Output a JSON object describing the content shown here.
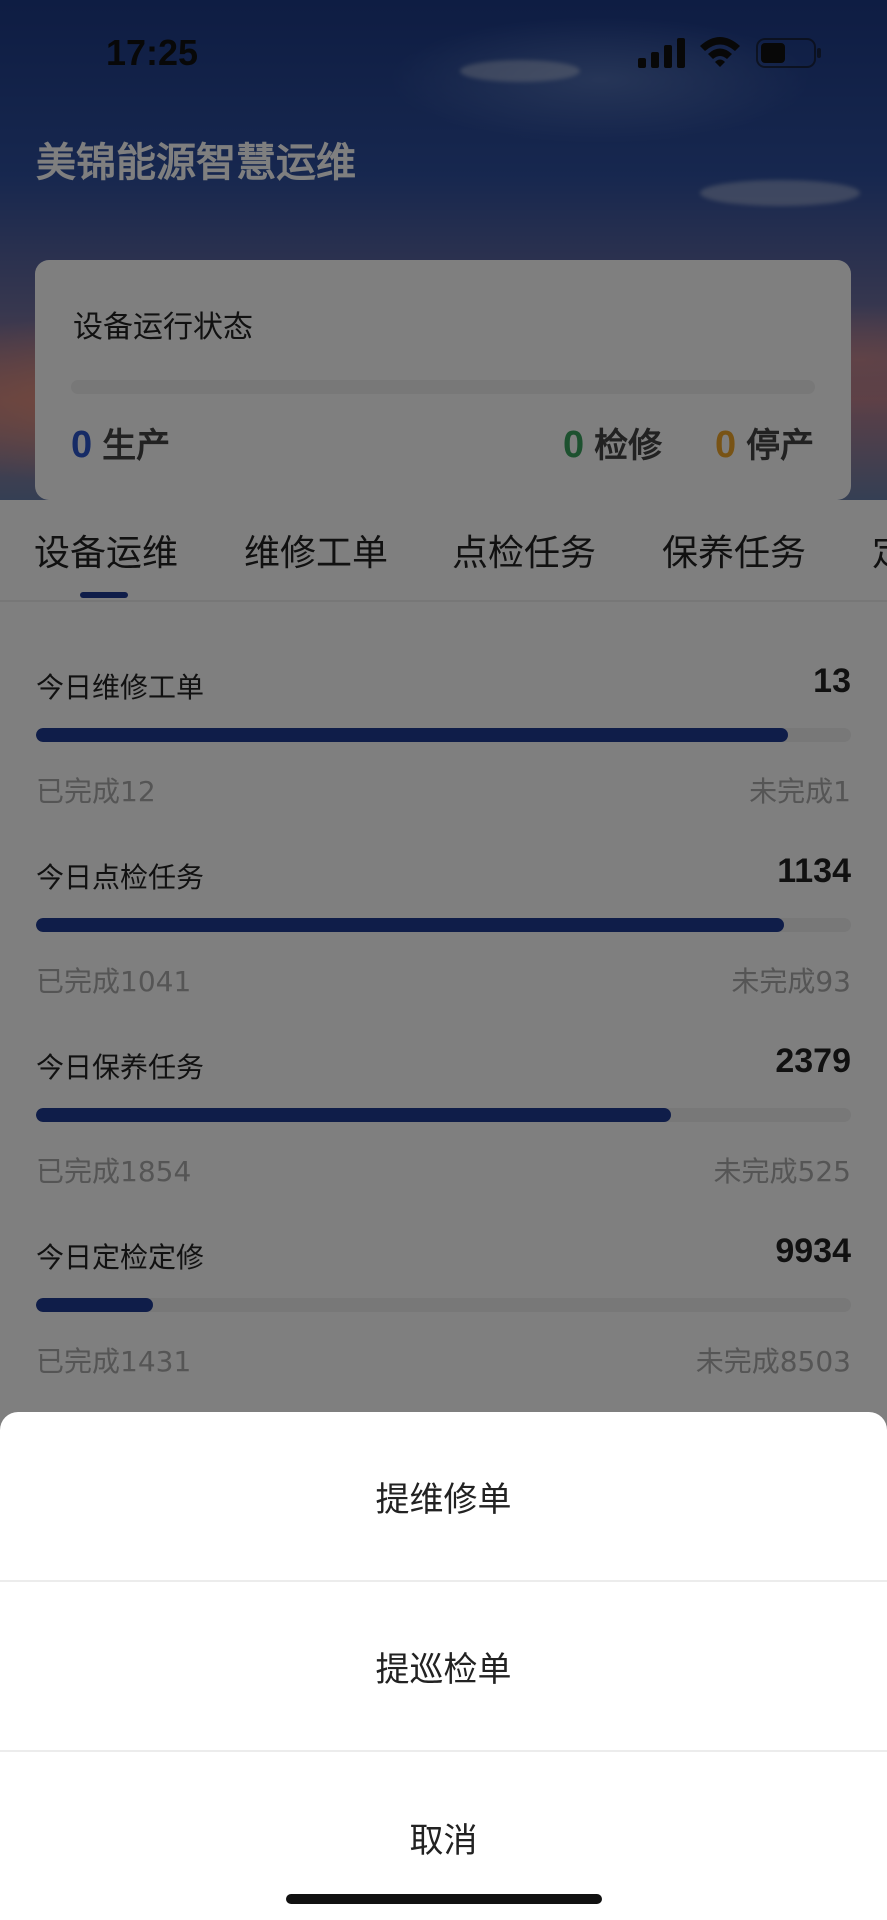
{
  "status_bar": {
    "time": "17:25"
  },
  "header": {
    "title": "美锦能源智慧运维"
  },
  "device_status": {
    "title": "设备运行状态",
    "production": {
      "count": "0",
      "label": "生产",
      "color": "#2d56cc"
    },
    "maintenance": {
      "count": "0",
      "label": "检修",
      "color": "#3aa35f"
    },
    "stopped": {
      "count": "0",
      "label": "停产",
      "color": "#f0a72a"
    }
  },
  "tabs": [
    {
      "label": "设备运维",
      "active": true
    },
    {
      "label": "维修工单",
      "active": false
    },
    {
      "label": "点检任务",
      "active": false
    },
    {
      "label": "保养任务",
      "active": false
    },
    {
      "label": "定",
      "active": false
    }
  ],
  "stats": [
    {
      "label": "今日维修工单",
      "total": "13",
      "done": "已完成12",
      "undone": "未完成1",
      "progress": 0.923
    },
    {
      "label": "今日点检任务",
      "total": "1134",
      "done": "已完成1041",
      "undone": "未完成93",
      "progress": 0.918
    },
    {
      "label": "今日保养任务",
      "total": "2379",
      "done": "已完成1854",
      "undone": "未完成525",
      "progress": 0.779
    },
    {
      "label": "今日定检定修",
      "total": "9934",
      "done": "已完成1431",
      "undone": "未完成8503",
      "progress": 0.144
    }
  ],
  "action_sheet": {
    "items": [
      {
        "label": "提维修单"
      },
      {
        "label": "提巡检单"
      },
      {
        "label": "取消"
      }
    ]
  },
  "colors": {
    "primary": "#1f3a93",
    "track": "#f1f1f1"
  }
}
